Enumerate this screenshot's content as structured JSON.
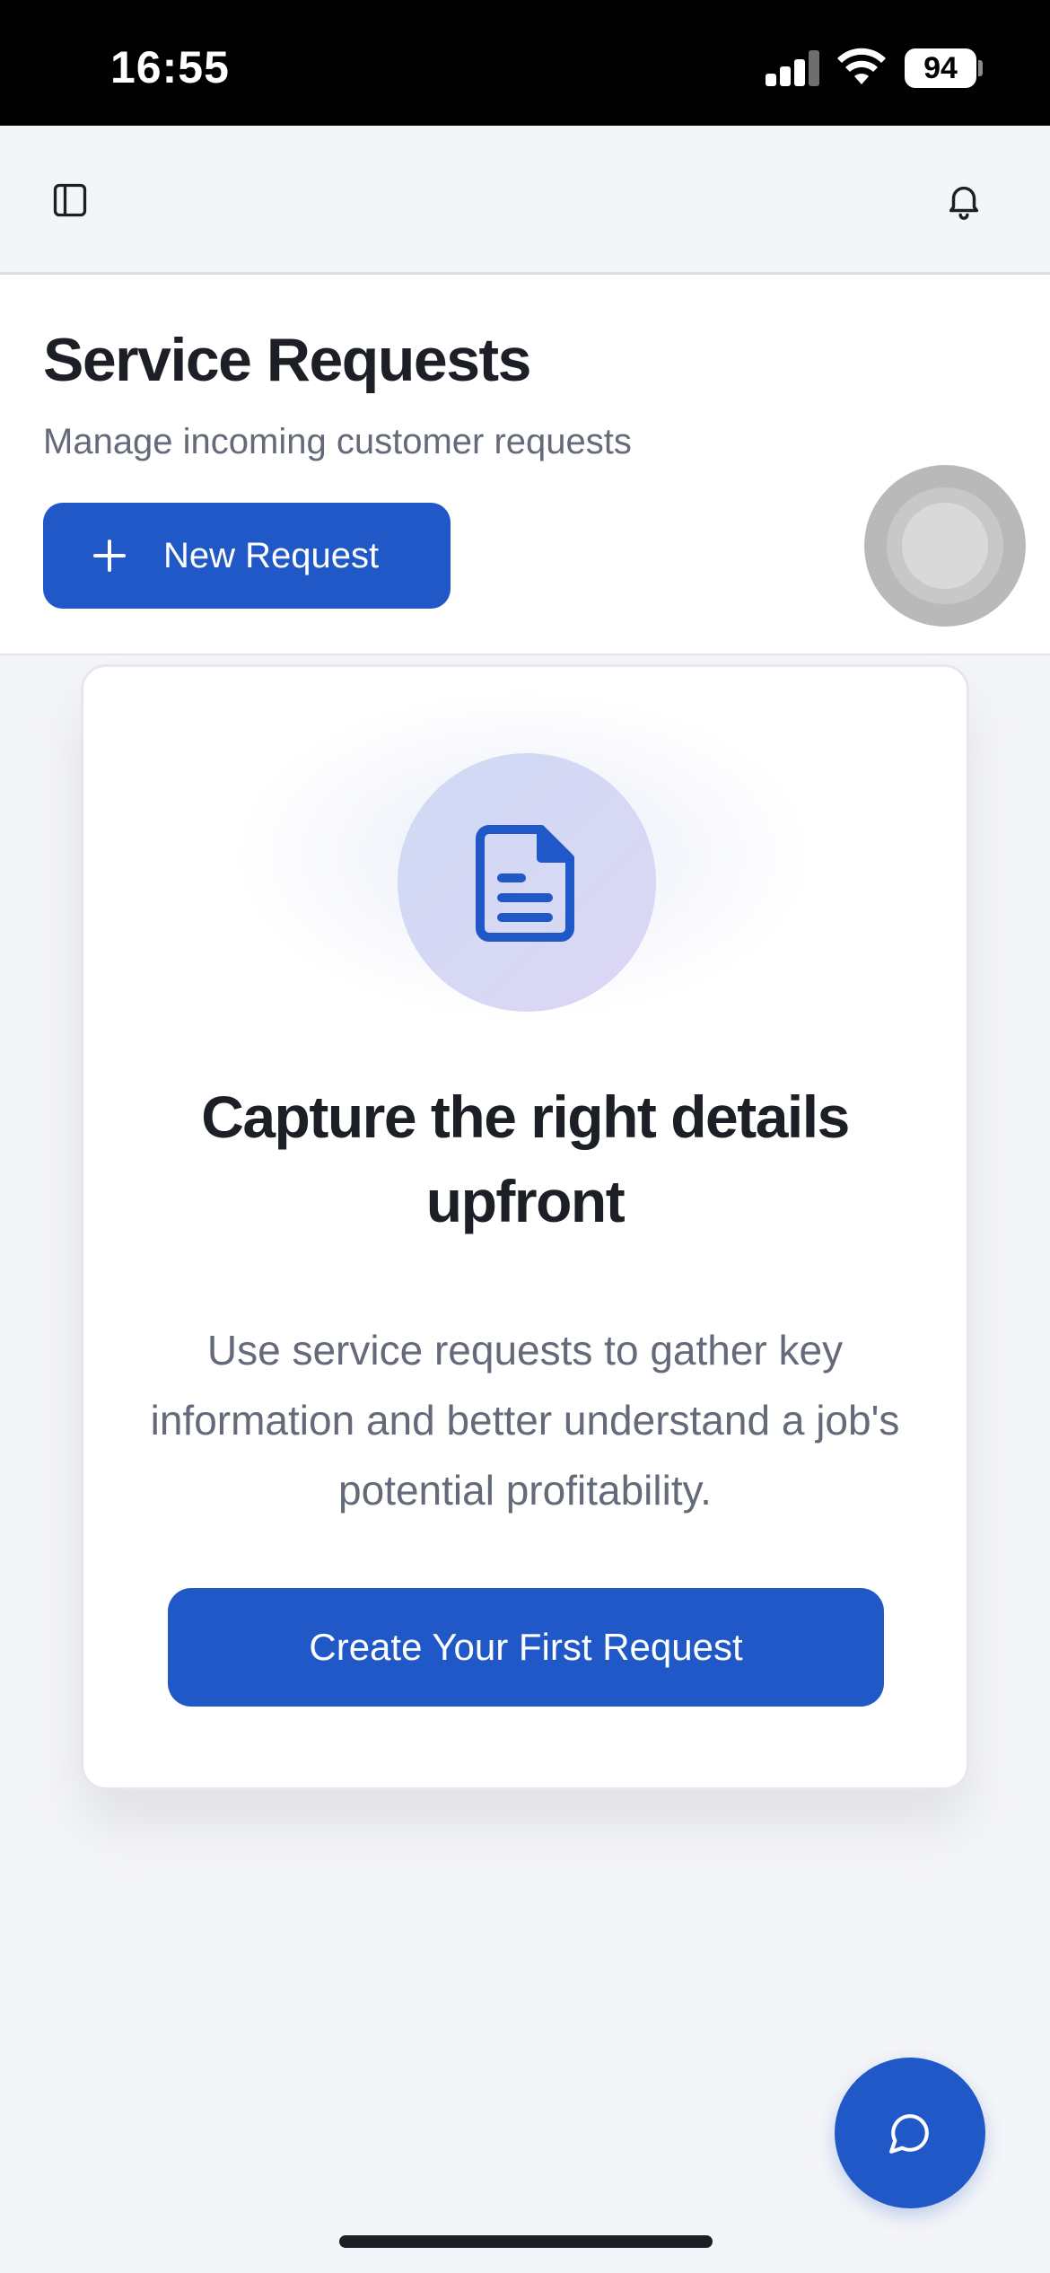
{
  "status_bar": {
    "time": "16:55",
    "battery": "94"
  },
  "top_nav": {
    "sidebar_icon": "sidebar-toggle-icon",
    "notification_icon": "bell-icon"
  },
  "header": {
    "title": "Service Requests",
    "subtitle": "Manage incoming customer requests",
    "new_request_label": "New Request"
  },
  "empty_state": {
    "icon": "document-icon",
    "heading": "Capture the right details upfront",
    "body": "Use service requests to gather key information and better understand a job's potential profitability.",
    "cta_label": "Create Your First Request"
  },
  "chat": {
    "icon": "chat-bubble-icon"
  },
  "colors": {
    "primary": "#2058c7",
    "title_text": "#1d1f27",
    "muted_text": "#646a7a",
    "background": "#f4f5f8"
  }
}
